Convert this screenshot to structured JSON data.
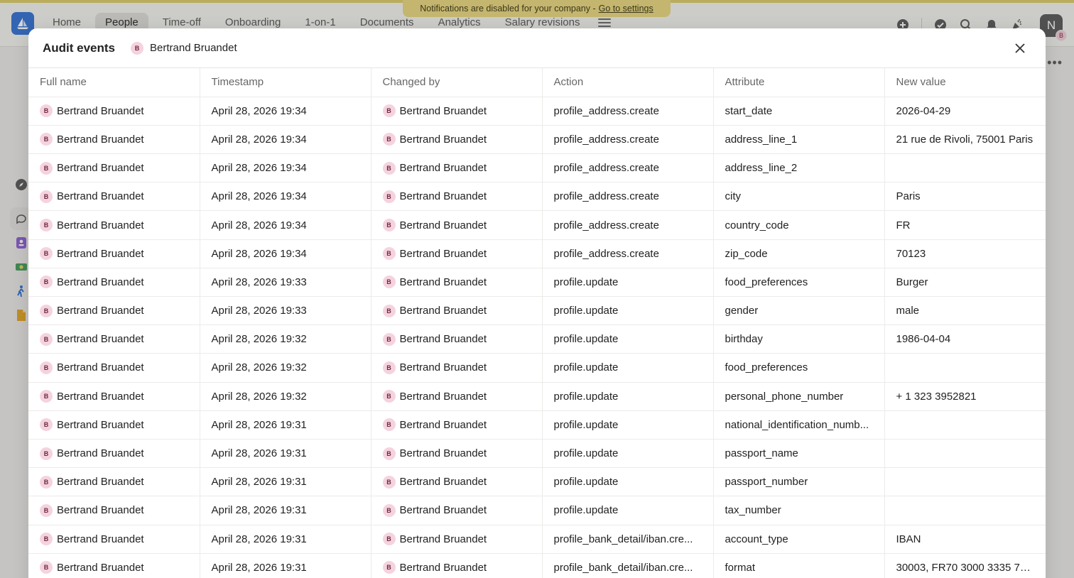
{
  "notice": {
    "text": "Notifications are disabled for your company -",
    "link": "Go to settings"
  },
  "nav": {
    "items": [
      {
        "label": "Home",
        "active": false
      },
      {
        "label": "People",
        "active": true
      },
      {
        "label": "Time-off",
        "active": false
      },
      {
        "label": "Onboarding",
        "active": false
      },
      {
        "label": "1-on-1",
        "active": false
      },
      {
        "label": "Documents",
        "active": false
      },
      {
        "label": "Analytics",
        "active": false
      },
      {
        "label": "Salary revisions",
        "active": false
      }
    ]
  },
  "user": {
    "initial": "N",
    "badge": "B"
  },
  "more_menu": "•••",
  "modal": {
    "title": "Audit events",
    "subject": {
      "initial": "B",
      "name": "Bertrand Bruandet"
    }
  },
  "table": {
    "columns": [
      "Full name",
      "Timestamp",
      "Changed by",
      "Action",
      "Attribute",
      "New value"
    ],
    "avatar_initial": "B",
    "rows": [
      {
        "full_name": "Bertrand Bruandet",
        "timestamp": "April 28, 2026 19:34",
        "changed_by": "Bertrand Bruandet",
        "action": "profile_address.create",
        "attribute": "start_date",
        "new_value": "2026-04-29"
      },
      {
        "full_name": "Bertrand Bruandet",
        "timestamp": "April 28, 2026 19:34",
        "changed_by": "Bertrand Bruandet",
        "action": "profile_address.create",
        "attribute": "address_line_1",
        "new_value": "21 rue de Rivoli, 75001 Paris"
      },
      {
        "full_name": "Bertrand Bruandet",
        "timestamp": "April 28, 2026 19:34",
        "changed_by": "Bertrand Bruandet",
        "action": "profile_address.create",
        "attribute": "address_line_2",
        "new_value": ""
      },
      {
        "full_name": "Bertrand Bruandet",
        "timestamp": "April 28, 2026 19:34",
        "changed_by": "Bertrand Bruandet",
        "action": "profile_address.create",
        "attribute": "city",
        "new_value": "Paris"
      },
      {
        "full_name": "Bertrand Bruandet",
        "timestamp": "April 28, 2026 19:34",
        "changed_by": "Bertrand Bruandet",
        "action": "profile_address.create",
        "attribute": "country_code",
        "new_value": "FR"
      },
      {
        "full_name": "Bertrand Bruandet",
        "timestamp": "April 28, 2026 19:34",
        "changed_by": "Bertrand Bruandet",
        "action": "profile_address.create",
        "attribute": "zip_code",
        "new_value": "70123"
      },
      {
        "full_name": "Bertrand Bruandet",
        "timestamp": "April 28, 2026 19:33",
        "changed_by": "Bertrand Bruandet",
        "action": "profile.update",
        "attribute": "food_preferences",
        "new_value": "Burger"
      },
      {
        "full_name": "Bertrand Bruandet",
        "timestamp": "April 28, 2026 19:33",
        "changed_by": "Bertrand Bruandet",
        "action": "profile.update",
        "attribute": "gender",
        "new_value": "male"
      },
      {
        "full_name": "Bertrand Bruandet",
        "timestamp": "April 28, 2026 19:32",
        "changed_by": "Bertrand Bruandet",
        "action": "profile.update",
        "attribute": "birthday",
        "new_value": "1986-04-04"
      },
      {
        "full_name": "Bertrand Bruandet",
        "timestamp": "April 28, 2026 19:32",
        "changed_by": "Bertrand Bruandet",
        "action": "profile.update",
        "attribute": "food_preferences",
        "new_value": ""
      },
      {
        "full_name": "Bertrand Bruandet",
        "timestamp": "April 28, 2026 19:32",
        "changed_by": "Bertrand Bruandet",
        "action": "profile.update",
        "attribute": "personal_phone_number",
        "new_value": "+ 1 323 3952821"
      },
      {
        "full_name": "Bertrand Bruandet",
        "timestamp": "April 28, 2026 19:31",
        "changed_by": "Bertrand Bruandet",
        "action": "profile.update",
        "attribute": "national_identification_numb...",
        "new_value": ""
      },
      {
        "full_name": "Bertrand Bruandet",
        "timestamp": "April 28, 2026 19:31",
        "changed_by": "Bertrand Bruandet",
        "action": "profile.update",
        "attribute": "passport_name",
        "new_value": ""
      },
      {
        "full_name": "Bertrand Bruandet",
        "timestamp": "April 28, 2026 19:31",
        "changed_by": "Bertrand Bruandet",
        "action": "profile.update",
        "attribute": "passport_number",
        "new_value": ""
      },
      {
        "full_name": "Bertrand Bruandet",
        "timestamp": "April 28, 2026 19:31",
        "changed_by": "Bertrand Bruandet",
        "action": "profile.update",
        "attribute": "tax_number",
        "new_value": ""
      },
      {
        "full_name": "Bertrand Bruandet",
        "timestamp": "April 28, 2026 19:31",
        "changed_by": "Bertrand Bruandet",
        "action": "profile_bank_detail/iban.cre...",
        "attribute": "account_type",
        "new_value": "IBAN"
      },
      {
        "full_name": "Bertrand Bruandet",
        "timestamp": "April 28, 2026 19:31",
        "changed_by": "Bertrand Bruandet",
        "action": "profile_bank_detail/iban.cre...",
        "attribute": "format",
        "new_value": "30003, FR70 3000 3335 79..."
      }
    ]
  },
  "colors": {
    "accent": "#2f6fd1",
    "notice_bg": "#e8d67a",
    "avatar_bg": "#f5d3de",
    "avatar_fg": "#6b2a3d"
  }
}
